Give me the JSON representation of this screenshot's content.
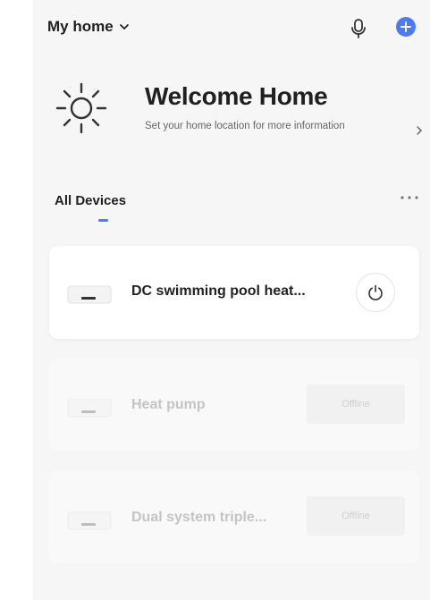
{
  "header": {
    "home_name": "My home",
    "icons": [
      "chevron-down-icon",
      "microphone-icon",
      "plus-icon"
    ],
    "accent_color": "#4c7cf3"
  },
  "welcome": {
    "title": "Welcome Home",
    "subtitle": "Set your home location for more information",
    "icon": "sun-icon"
  },
  "tabs": {
    "active": "All Devices"
  },
  "devices": [
    {
      "name": "DC swimming pool heat...",
      "status": "online",
      "action_icon": "power-icon"
    },
    {
      "name": "Heat pump",
      "status": "offline",
      "status_label": "Offline"
    },
    {
      "name": "Dual system triple...",
      "status": "offline",
      "status_label": "Offline"
    }
  ]
}
